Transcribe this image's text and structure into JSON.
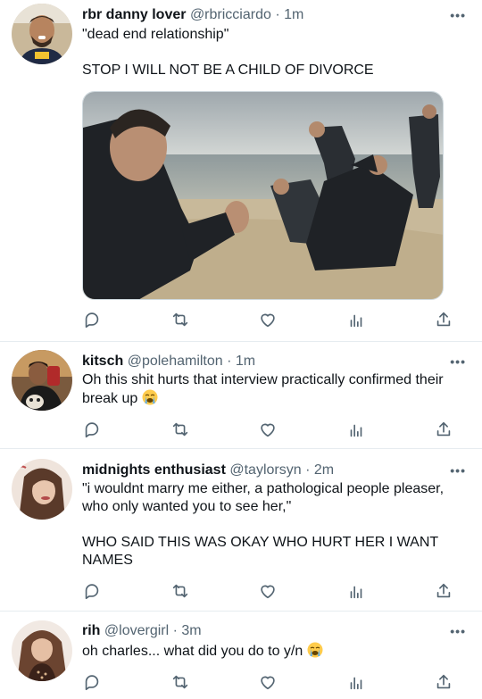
{
  "tweets": [
    {
      "name": "rbr danny lover",
      "handle": "@rbricciardo",
      "dot": "·",
      "time": "1m",
      "text_lines": [
        "\"dead end relationship\"",
        "",
        "STOP I WILL NOT BE A CHILD OF DIVORCE"
      ],
      "has_media": true
    },
    {
      "name": "kitsch",
      "handle": "@polehamilton",
      "dot": "·",
      "time": "1m",
      "text_lines": [
        "Oh this shit hurts that interview practically confirmed their",
        "break up"
      ]
    },
    {
      "name": "midnights enthusiast",
      "handle": "@taylorsyn",
      "dot": "·",
      "time": "2m",
      "text_lines": [
        "\"i wouldnt marry me either, a pathological people pleaser,",
        "who only wanted you to see her,\"",
        "",
        "WHO SAID THIS WAS OKAY WHO HURT HER I WANT",
        "NAMES"
      ]
    },
    {
      "name": "rih",
      "handle": "@lovergirl",
      "dot": "·",
      "time": "3m",
      "text_lines": [
        "oh charles... what did you do to y/n"
      ]
    }
  ],
  "more_label": "•••",
  "icons": {
    "reply": "reply-icon",
    "retweet": "retweet-icon",
    "like": "heart-icon",
    "views": "views-icon",
    "share": "share-icon",
    "emoji": "crying-face-emoji"
  },
  "colors": {
    "text": "#0f1419",
    "muted": "#536471",
    "divider": "#e6ecf0"
  }
}
